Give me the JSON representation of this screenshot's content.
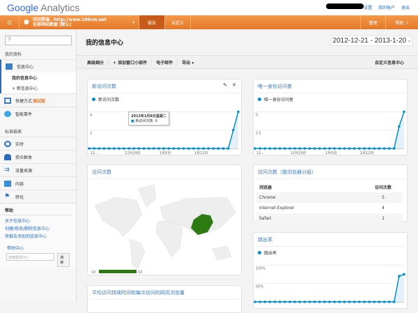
{
  "header": {
    "logo_google": "Google",
    "logo_analytics": "Analytics",
    "links": [
      "设置",
      "我的帐户",
      "退出"
    ]
  },
  "nav": {
    "account_line1": "浏浏雯瑞 . http://www.186cm.net",
    "account_line2": "全部网站数据 [默认]",
    "tabs": [
      "报告",
      "自定义"
    ],
    "right": [
      "管理",
      "帮助 ↗"
    ]
  },
  "sidebar": {
    "search_placeholder": "",
    "section1": "我的资料",
    "dashboard": "信息中心",
    "my_dashboard": "我的信息中心",
    "new_dashboard": "+ 新信息中心",
    "shortcuts": "快捷方式",
    "beta": "测试版",
    "intel": "智能事件",
    "section2": "标准报表",
    "items": [
      "实时",
      "受众群体",
      "流量来源",
      "内容",
      "转化"
    ],
    "help_title": "帮助",
    "help_links": [
      "关于信息中心",
      "创建/修改/删除信息中心",
      "将报告添加到信息中心"
    ],
    "help_center": "帮助中心",
    "help_placeholder": "搜索帮助中心",
    "help_search": "搜索"
  },
  "main": {
    "title": "我的信息中心",
    "date_range": "2012-12-21 - 2013-1-20",
    "toolbar": [
      "高级细分",
      "+ 添加窗口小部件",
      "电子邮件",
      "导出 ▾"
    ],
    "customize": "自定义信息中心"
  },
  "widgets": {
    "new_visits": {
      "title": "新访问次数",
      "legend": "新访问次数",
      "tooltip_date": "2013年1月8日星期二",
      "tooltip_value": "新访问次数: 0"
    },
    "unique": {
      "title": "唯一身份访问者",
      "legend": "唯一身份访问者"
    },
    "map": {
      "title": "访问次数",
      "min": "10",
      "max": "10"
    },
    "browser": {
      "title": "访问次数（按浏览器分组）",
      "headers": [
        "浏览器",
        "访问次数"
      ],
      "rows": [
        [
          "Chrome",
          "5"
        ],
        [
          "Internet Explorer",
          "4"
        ],
        [
          "Safari",
          "1"
        ]
      ]
    },
    "bounce": {
      "title": "跳出率",
      "legend": "跳出率"
    },
    "avg": {
      "title": "平均访问持续时间和每次访问的网页浏览量"
    }
  },
  "chart_data": [
    {
      "type": "line",
      "name": "新访问次数",
      "x_ticks": [
        "12...",
        "12月29日",
        "1月5日",
        "1月12日"
      ],
      "y_ticks": [
        "2",
        "4"
      ],
      "ylim": [
        0,
        4.4
      ],
      "values": [
        0,
        0,
        0,
        0,
        0,
        0,
        0,
        0,
        0,
        0,
        0,
        0,
        0,
        0,
        0,
        0,
        0,
        0,
        0,
        0,
        0,
        0,
        0,
        0,
        0,
        0,
        0,
        0,
        0,
        2,
        4
      ]
    },
    {
      "type": "line",
      "name": "唯一身份访问者",
      "x_ticks": [
        "12...",
        "12月29日",
        "1月5日",
        "1月12日"
      ],
      "y_ticks": [
        "2.5",
        "5"
      ],
      "ylim": [
        0,
        5.5
      ],
      "values": [
        0,
        0,
        0,
        0,
        0,
        0,
        0,
        0,
        0,
        0,
        0,
        0,
        0,
        0,
        0,
        0,
        0,
        0,
        0,
        0,
        0,
        0,
        0,
        0,
        0,
        0,
        0,
        0,
        0,
        3,
        5
      ]
    },
    {
      "type": "line",
      "name": "跳出率",
      "x_ticks": [],
      "y_ticks": [
        "50%",
        "100%"
      ],
      "ylim": [
        0,
        110
      ],
      "values": [
        0,
        0,
        0,
        0,
        0,
        0,
        0,
        0,
        0,
        0,
        0,
        0,
        0,
        0,
        0,
        0,
        0,
        0,
        0,
        0,
        0,
        0,
        0,
        0,
        0,
        0,
        0,
        0,
        0,
        70,
        75
      ]
    }
  ]
}
